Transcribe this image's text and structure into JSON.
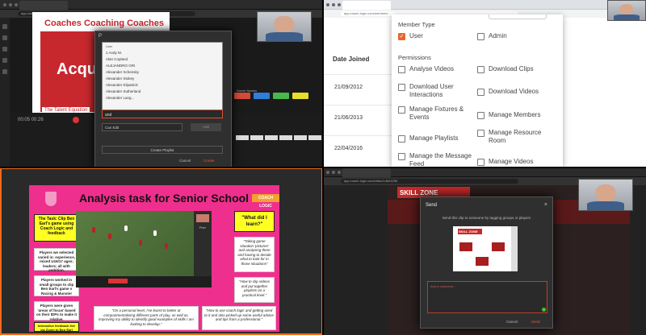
{
  "q1": {
    "url": "app.coach-logic.com/video/15694872",
    "slide_title": "Coaches Coaching Coaches",
    "slide_logo": "Acqu",
    "slide_footer": "The Talent Equation",
    "controls": "00:05   00:26",
    "dialog": {
      "header": "P",
      "list_caption": "User",
      "users": [
        "1 Andy M.",
        "Alan Copland",
        "ALEJANDRO GRI",
        "Alexander Schensky",
        "Alexander Stokey",
        "Alexander Kilpatrick",
        "Alexander Sutherland",
        "Alexander Lang..."
      ],
      "input_value": "and",
      "permission_value": "Can Edit",
      "add_label": "Add",
      "create_playlist_label": "Create Playlist",
      "cancel_label": "Cancel",
      "create_label": "Create"
    },
    "scene_label": "Scene Names",
    "chip_colors": [
      "#d44a3a",
      "#2f7ed8",
      "#49b84a",
      "#e7de2b"
    ]
  },
  "q2": {
    "url": "app.coach-logic.com/members",
    "column_header": "Date Joined",
    "dates": [
      "21/09/2012",
      "21/06/2013",
      "22/04/2016"
    ],
    "member_type_heading": "Member Type",
    "member_types": [
      {
        "label": "User",
        "checked": true
      },
      {
        "label": "Admin",
        "checked": false
      }
    ],
    "permissions_heading": "Permissions",
    "permissions": [
      "Analyse Videos",
      "Download Clips",
      "Download User Interactions",
      "Download Videos",
      "Manage Fixtures & Events",
      "Manage Members",
      "Manage Playlists",
      "Manage Resource Room",
      "Manage the Message Feed",
      "Manage Videos"
    ]
  },
  "q3": {
    "poster_title": "Analysis task for Senior School",
    "coach_logic_badge": "COACH LOGIC",
    "task": "The Task: Clip Ben Earl's game using Coach Logic and feedback",
    "boxes_left": [
      "Players we selected varied in: experience, mixed U16/17 ages; leaders; all with ambition.",
      "Players worked in small groups to clip Ben Earl's game v Racing & Munster",
      "Players were given 'areas of focus' based on their IDPs to make it relative.",
      "Interactive feedback live via Zoom to Ben Earl using Coach Logic"
    ],
    "what_did_i_learn": "\"What did I learn?\"",
    "quotes_right": [
      "\"Taking game situation 'pictures' and analysing them and having to decide what to look for in those situations\"",
      "\"How to clip videos and put together playlists on a practical level.\""
    ],
    "quote_bottom_left": "\"On a personal level, I've learnt to better at compartmentalising different parts of play, as well as, improving my ability to identify good examples of skills I am looking to develop.\"",
    "quote_bottom_right": "\"How to use coach logic and getting used to it and also picked up some useful advice and tips from a professional.\"",
    "side_label": "Prev"
  },
  "q4": {
    "url": "app.coach-logic.com/video/14844255",
    "skill_zone": "SKILL ZONE",
    "modal_title": "Send",
    "close_glyph": "×",
    "description": "Send this clip to someone by tagging groups or players",
    "textarea_placeholder": "Add a comment...",
    "cancel_label": "Cancel",
    "send_label": "Send"
  }
}
